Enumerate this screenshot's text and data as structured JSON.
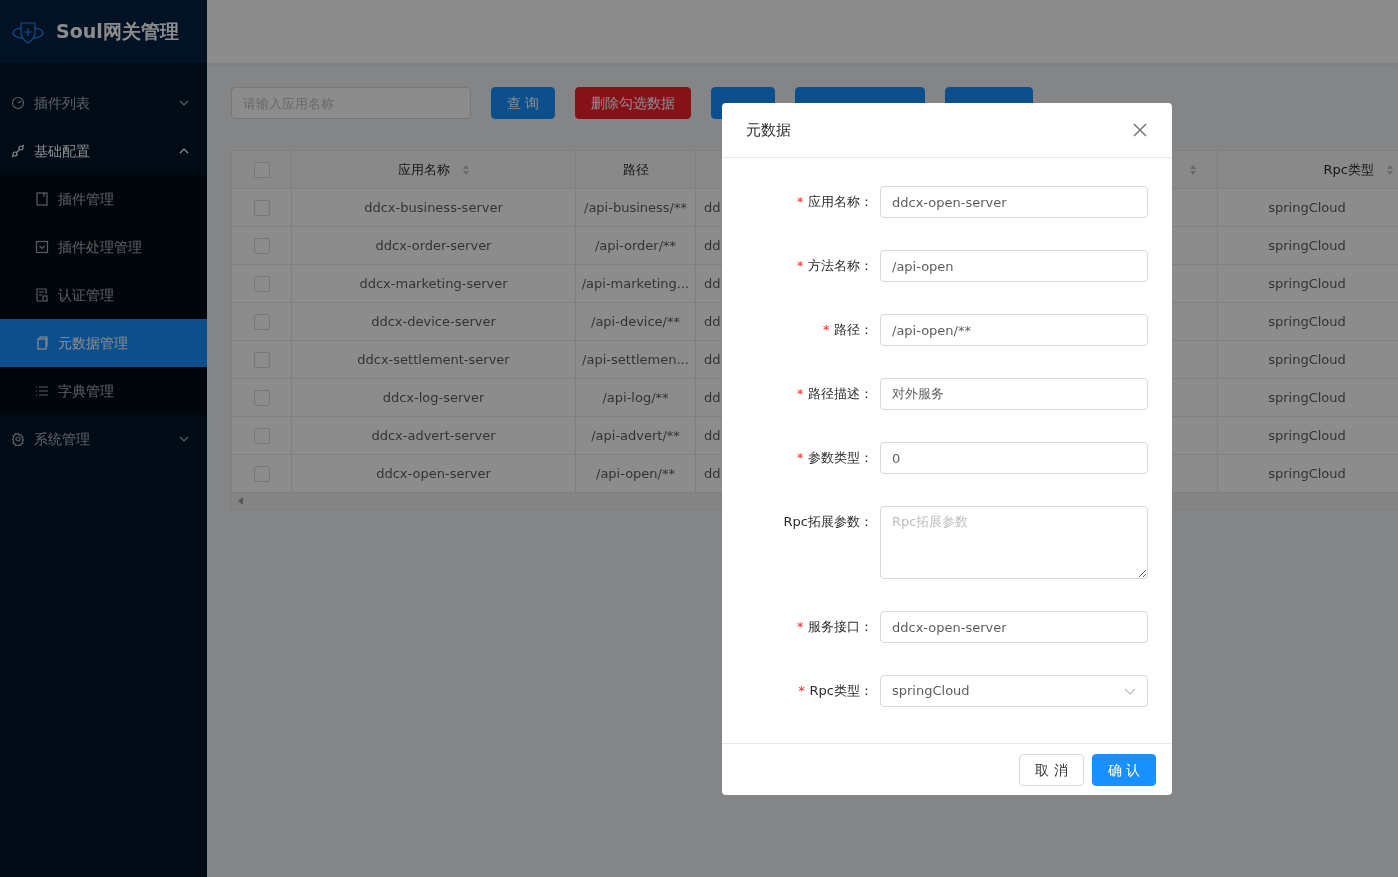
{
  "sidebar": {
    "title": "Soul网关管理",
    "items": [
      {
        "label": "插件列表",
        "expanded": false,
        "selected": false
      },
      {
        "label": "基础配置",
        "expanded": true,
        "selected": false,
        "children": [
          {
            "label": "插件管理",
            "selected": false
          },
          {
            "label": "插件处理管理",
            "selected": false
          },
          {
            "label": "认证管理",
            "selected": false
          },
          {
            "label": "元数据管理",
            "selected": true
          },
          {
            "label": "字典管理",
            "selected": false
          }
        ]
      },
      {
        "label": "系统管理",
        "expanded": false,
        "selected": false
      }
    ]
  },
  "toolbar": {
    "search": {
      "placeholder": "请输入应用名称"
    },
    "buttons": [
      {
        "label": "查 询",
        "kind": "primary"
      },
      {
        "label": "删除勾选数据",
        "kind": "danger"
      },
      {
        "kind": "primary"
      },
      {
        "kind": "primary"
      },
      {
        "kind": "primary"
      }
    ]
  },
  "table": {
    "header_checked": false,
    "columns": [
      {
        "label": "应用名称",
        "sortable": true
      },
      {
        "label": "路径",
        "sortable": false
      },
      {
        "sortable": true
      },
      {
        "label": "Rpc类型",
        "sortable": true
      }
    ],
    "rows": [
      {
        "checked": false,
        "cells": [
          "ddcx-business-server",
          "/api-business/**",
          "dd",
          "springCloud"
        ]
      },
      {
        "checked": false,
        "cells": [
          "ddcx-order-server",
          "/api-order/**",
          "dd",
          "springCloud"
        ]
      },
      {
        "checked": false,
        "cells": [
          "ddcx-marketing-server",
          "/api-marketing...",
          "dd",
          "springCloud"
        ]
      },
      {
        "checked": false,
        "cells": [
          "ddcx-device-server",
          "/api-device/**",
          "dd",
          "springCloud"
        ]
      },
      {
        "checked": false,
        "cells": [
          "ddcx-settlement-server",
          "/api-settlemen...",
          "dd",
          "springCloud"
        ]
      },
      {
        "checked": false,
        "cells": [
          "ddcx-log-server",
          "/api-log/**",
          "dd",
          "springCloud"
        ]
      },
      {
        "checked": false,
        "cells": [
          "ddcx-advert-server",
          "/api-advert/**",
          "dd",
          "springCloud"
        ]
      },
      {
        "checked": false,
        "cells": [
          "ddcx-open-server",
          "/api-open/**",
          "dd",
          "springCloud"
        ]
      }
    ]
  },
  "modal": {
    "title": "元数据",
    "fields": [
      {
        "mark": "*",
        "label": "应用名称：",
        "kind": "input",
        "value": "ddcx-open-server"
      },
      {
        "mark": "*",
        "label": "方法名称：",
        "kind": "input",
        "value": "/api-open"
      },
      {
        "mark": "*",
        "label": "路径：",
        "kind": "input",
        "value": "/api-open/**"
      },
      {
        "mark": "*",
        "label": "路径描述：",
        "kind": "input",
        "value": "对外服务"
      },
      {
        "mark": "*",
        "label": "参数类型：",
        "kind": "input",
        "value": "0"
      },
      {
        "label": "Rpc拓展参数：",
        "kind": "textarea",
        "placeholder": "Rpc拓展参数"
      },
      {
        "mark": "*",
        "label": "服务接口：",
        "kind": "input",
        "value": "ddcx-open-server"
      },
      {
        "mark": "*",
        "label": "Rpc类型：",
        "kind": "select",
        "value": "springCloud"
      }
    ],
    "buttons": [
      {
        "label": "取 消",
        "kind": "default"
      },
      {
        "label": "确 认",
        "kind": "primary"
      }
    ]
  }
}
